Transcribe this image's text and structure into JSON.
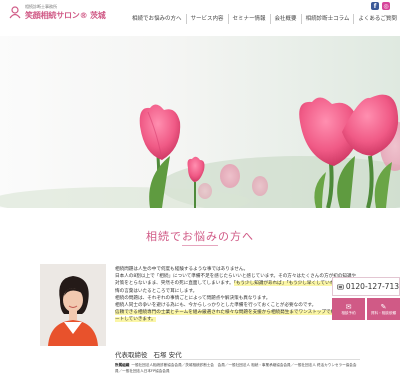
{
  "header": {
    "logo_sub": "相続診断士事務所",
    "logo_name": "笑顔相続サロン® 茨城",
    "social": [
      {
        "icon": "facebook-icon",
        "glyph": "f",
        "color": "#3b5998"
      },
      {
        "icon": "instagram-icon",
        "glyph": "◎",
        "color": "#d6449a"
      }
    ]
  },
  "nav": {
    "items": [
      "相続でお悩みの方へ",
      "サービス内容",
      "セミナー情報",
      "会社概要",
      "相続診断士コラム",
      "よくあるご質問"
    ]
  },
  "main": {
    "section_title": "相続でお悩みの方へ",
    "paragraph1_a": "相続問題は人生の中で何度も経験するような事ではありません。",
    "paragraph1_b": "日本人の8割以上で「相続」について準備不足を感じたらいいと感じています。その方々はたくさんの方が初の知識や対策をとらないまま、突然その死に直面してしまいます。",
    "paragraph1_hl1": "「もう少し知識があれば」「もう少し早くしていれば」",
    "paragraph1_c": "と、後悔の言葉はいたるところで耳にします。",
    "paragraph2_a": "相続の問題は、それぞれの事情ごとによって問題点や解決策も異なります。",
    "paragraph2_b": "相続人同士の争いを避ける為にも、今からしっかりとした準備を行っておくことが必要なのです。",
    "paragraph2_hl": "信頼できる相続専門の士業とチームを組み厳選された様々な問題を支援から相続発生までワンストップで総合的にサポートしていきます。",
    "rep_role": "代表取締役",
    "rep_name": "石塚 安代",
    "affil_label": "所属組織",
    "affil_text": "一般社団法人相続診断協会会員／茨城相続診断士会　会員／一般社団法人 相続・事業承継協会会員／一般社団法人 終活カウンセラー協会会員／一般社団法人日本FP協会会員"
  },
  "side": {
    "tel": "0120-127-713",
    "btn1_icon": "✉",
    "btn1_label": "相談予約",
    "btn2_icon": "✎",
    "btn2_label": "資料・相談依頼"
  },
  "colors": {
    "accent": "#d05a86",
    "highlight": "#fbf6a6"
  }
}
